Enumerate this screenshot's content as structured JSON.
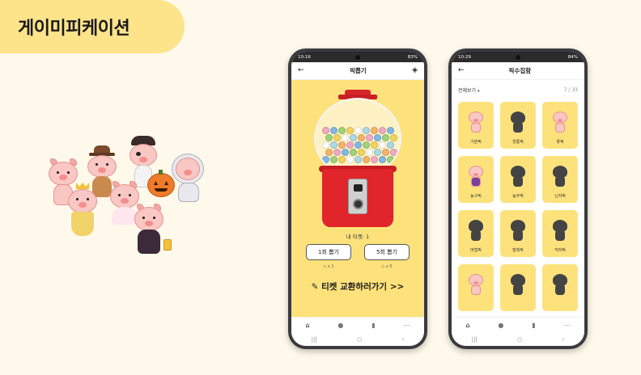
{
  "title": "게이미피케이션",
  "phone1": {
    "status": {
      "time": "10:16",
      "right": "83%"
    },
    "appbar": {
      "back": "←",
      "title": "픽뽑기",
      "menu": "◈"
    },
    "tickets": "내 티켓: 1",
    "buttons": {
      "one": "1회 뽑기",
      "five": "5회 뽑기"
    },
    "costs": {
      "one": "x 1",
      "five": "x 5"
    },
    "exchange": "티켓 교환하러가기 >>",
    "nav": [
      "⌂",
      "●",
      "▮",
      "⋯"
    ],
    "sysnav": [
      "|||",
      "○",
      "‹"
    ]
  },
  "phone2": {
    "status": {
      "time": "10:29",
      "right": "84%"
    },
    "appbar": {
      "back": "←",
      "title": "픽수집함"
    },
    "filter": {
      "label": "전체보기",
      "count": "7 / 33"
    },
    "cards": [
      {
        "label": "기본픽",
        "owned": true
      },
      {
        "label": "깡통픽",
        "owned": false
      },
      {
        "label": "꽃픽",
        "owned": true
      },
      {
        "label": "농구픽",
        "owned": true
      },
      {
        "label": "농부픽",
        "owned": false
      },
      {
        "label": "닌자픽",
        "owned": false
      },
      {
        "label": "마법픽",
        "owned": false
      },
      {
        "label": "발레픽",
        "owned": false
      },
      {
        "label": "악마픽",
        "owned": false
      },
      {
        "label": "",
        "owned": true
      },
      {
        "label": "",
        "owned": false
      },
      {
        "label": "",
        "owned": false
      }
    ],
    "nav": [
      "⌂",
      "●",
      "▮",
      "⋯"
    ],
    "sysnav": [
      "|||",
      "○",
      "‹"
    ]
  },
  "colors": {
    "tab": "#fde48a",
    "accent": "#fde27c",
    "machine_red": "#e0252b"
  }
}
